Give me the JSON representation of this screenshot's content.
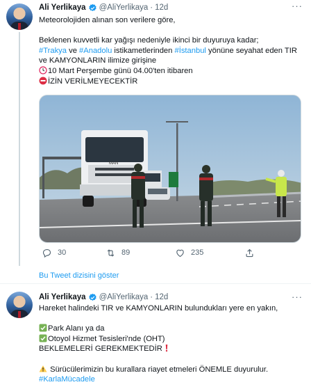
{
  "tweets": [
    {
      "author_name": "Ali Yerlikaya",
      "handle": "@AliYerlikaya",
      "separator": "·",
      "time": "12d",
      "more": "···",
      "lines": [
        [
          "Meteorolojiden alınan son verilere göre,"
        ],
        [],
        [
          "Beklenen kuvvetli kar yağışı nedeniyle ikinci bir duyuruya kadar;"
        ],
        [
          {
            "tag": "#Trakya"
          },
          " ve ",
          {
            "tag": "#Anadolu"
          },
          " istikametlerinden ",
          {
            "tag": "#İstanbul"
          },
          " yönüne seyahat eden TIR"
        ],
        [
          "ve KAMYONLARIN ilimize girişine"
        ],
        [
          {
            "emoji": "clock"
          },
          "10 Mart Perşembe günü 04.00'ten itibaren"
        ],
        [
          {
            "emoji": "no-entry"
          },
          "İZİN VERİLMEYECEKTİR"
        ]
      ],
      "reply_count": "30",
      "retweet_count": "89",
      "like_count": "235"
    },
    {
      "author_name": "Ali Yerlikaya",
      "handle": "@AliYerlikaya",
      "separator": "·",
      "time": "12d",
      "more": "···",
      "lines": [
        [
          "Hareket halindeki TIR ve KAMYONLARIN bulundukları yere en yakın,"
        ],
        [],
        [
          {
            "emoji": "check"
          },
          "Park Alanı ya da"
        ],
        [
          {
            "emoji": "check"
          },
          "Otoyol Hizmet Tesisleri'nde (OHT)"
        ],
        [
          "BEKLEMELERİ GEREKMEKTEDİR",
          {
            "emoji": "exclamation"
          }
        ],
        [],
        [
          {
            "emoji": "warning"
          },
          " Sürücülerimizin bu kurallara riayet etmeleri ÖNEMLE duyurulur."
        ],
        [
          {
            "tag": "#KarlaMücadele"
          }
        ]
      ]
    }
  ],
  "show_thread_label": "Bu Tweet dizisini göster",
  "colors": {
    "accent": "#1d9bf0",
    "secondary_text": "#536471",
    "primary_text": "#0f1419",
    "divider": "#eff3f4"
  }
}
